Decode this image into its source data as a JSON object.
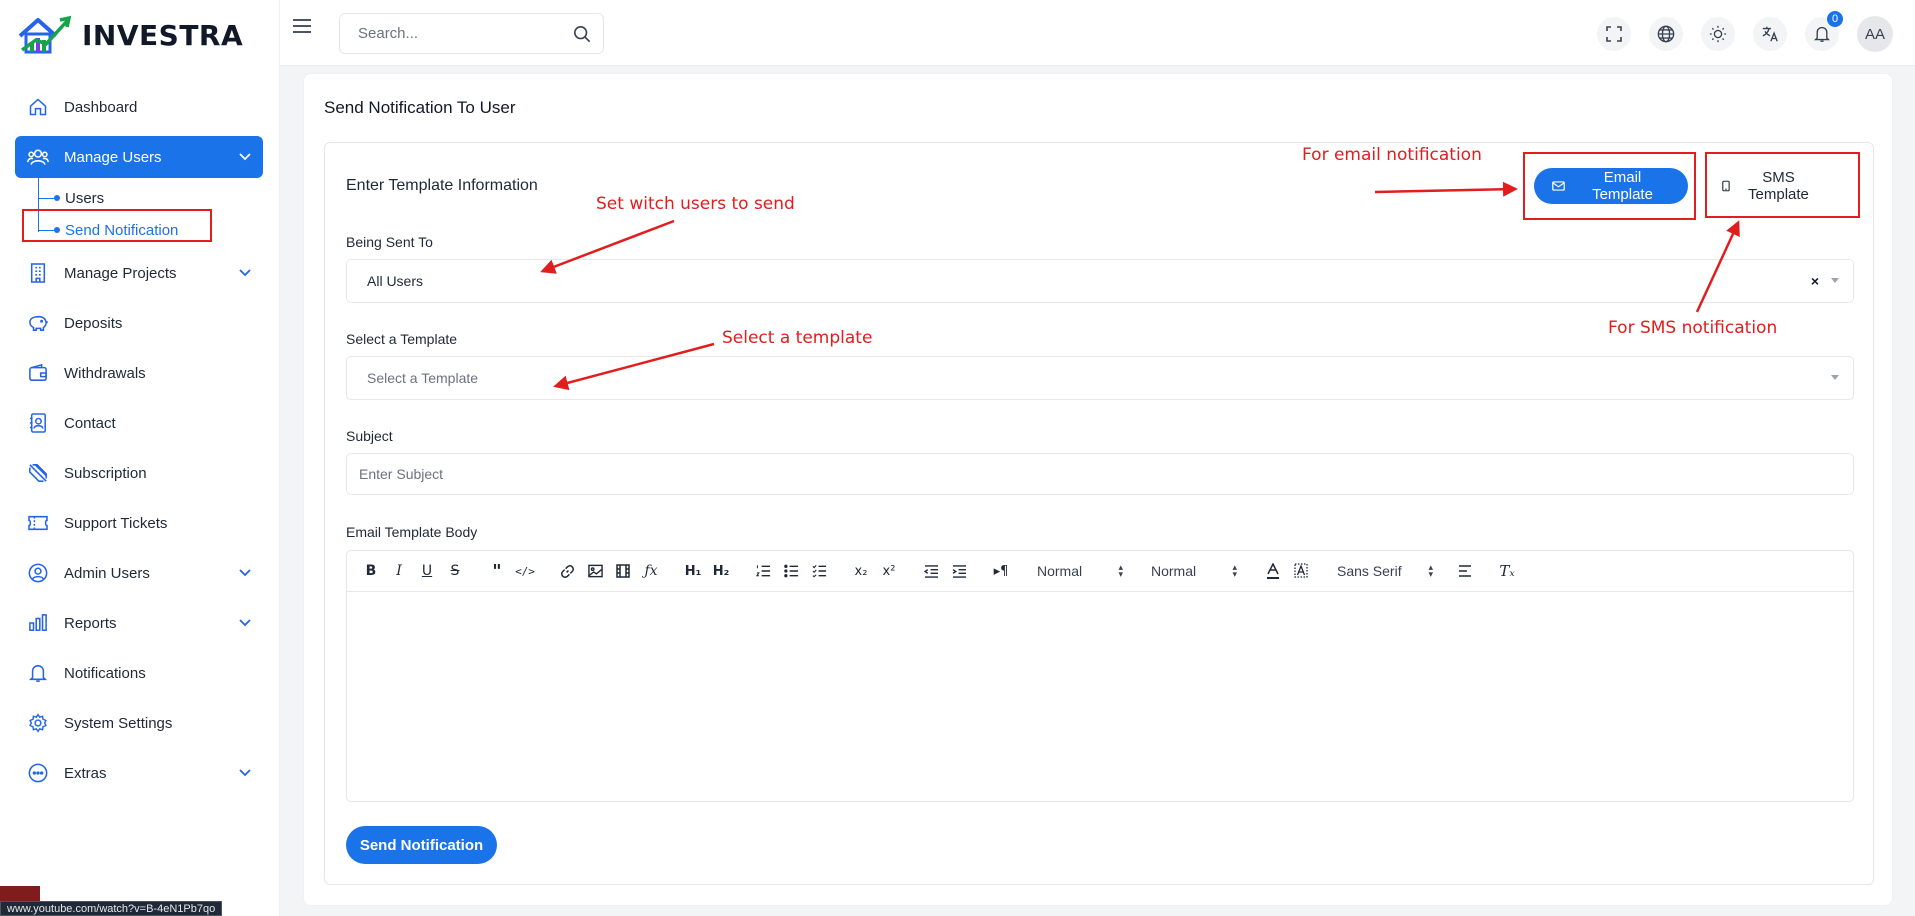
{
  "brand": {
    "name": "INVESTRA"
  },
  "search": {
    "placeholder": "Search..."
  },
  "notifications": {
    "count": "0"
  },
  "user": {
    "initials": "AA"
  },
  "sidebar": {
    "items": [
      {
        "label": "Dashboard"
      },
      {
        "label": "Manage Users"
      },
      {
        "label": "Manage Projects"
      },
      {
        "label": "Deposits"
      },
      {
        "label": "Withdrawals"
      },
      {
        "label": "Contact"
      },
      {
        "label": "Subscription"
      },
      {
        "label": "Support Tickets"
      },
      {
        "label": "Admin Users"
      },
      {
        "label": "Reports"
      },
      {
        "label": "Notifications"
      },
      {
        "label": "System Settings"
      },
      {
        "label": "Extras"
      }
    ],
    "sub_items": [
      {
        "label": "Users"
      },
      {
        "label": "Send Notification"
      }
    ]
  },
  "page": {
    "title": "Send Notification To User",
    "section_title": "Enter Template Information",
    "email_template_label": "Email Template",
    "sms_template_label": "SMS Template",
    "being_sent_to_label": "Being Sent To",
    "being_sent_to_value": "All Users",
    "select_template_label": "Select a Template",
    "select_template_placeholder": "Select a Template",
    "subject_label": "Subject",
    "subject_placeholder": "Enter Subject",
    "body_label": "Email Template Body",
    "send_button": "Send Notification"
  },
  "editor_toolbar": {
    "header_select": "Normal",
    "size_select": "Normal",
    "font_select": "Sans Serif"
  },
  "annotations": {
    "email": "For email notification",
    "sms": "For SMS notification",
    "users": "Set witch users to send",
    "template": "Select a template"
  },
  "status_url": "www.youtube.com/watch?v=B-4eN1Pb7qo",
  "colors": {
    "primary": "#1a73e8",
    "annotation": "#e11d1d"
  }
}
